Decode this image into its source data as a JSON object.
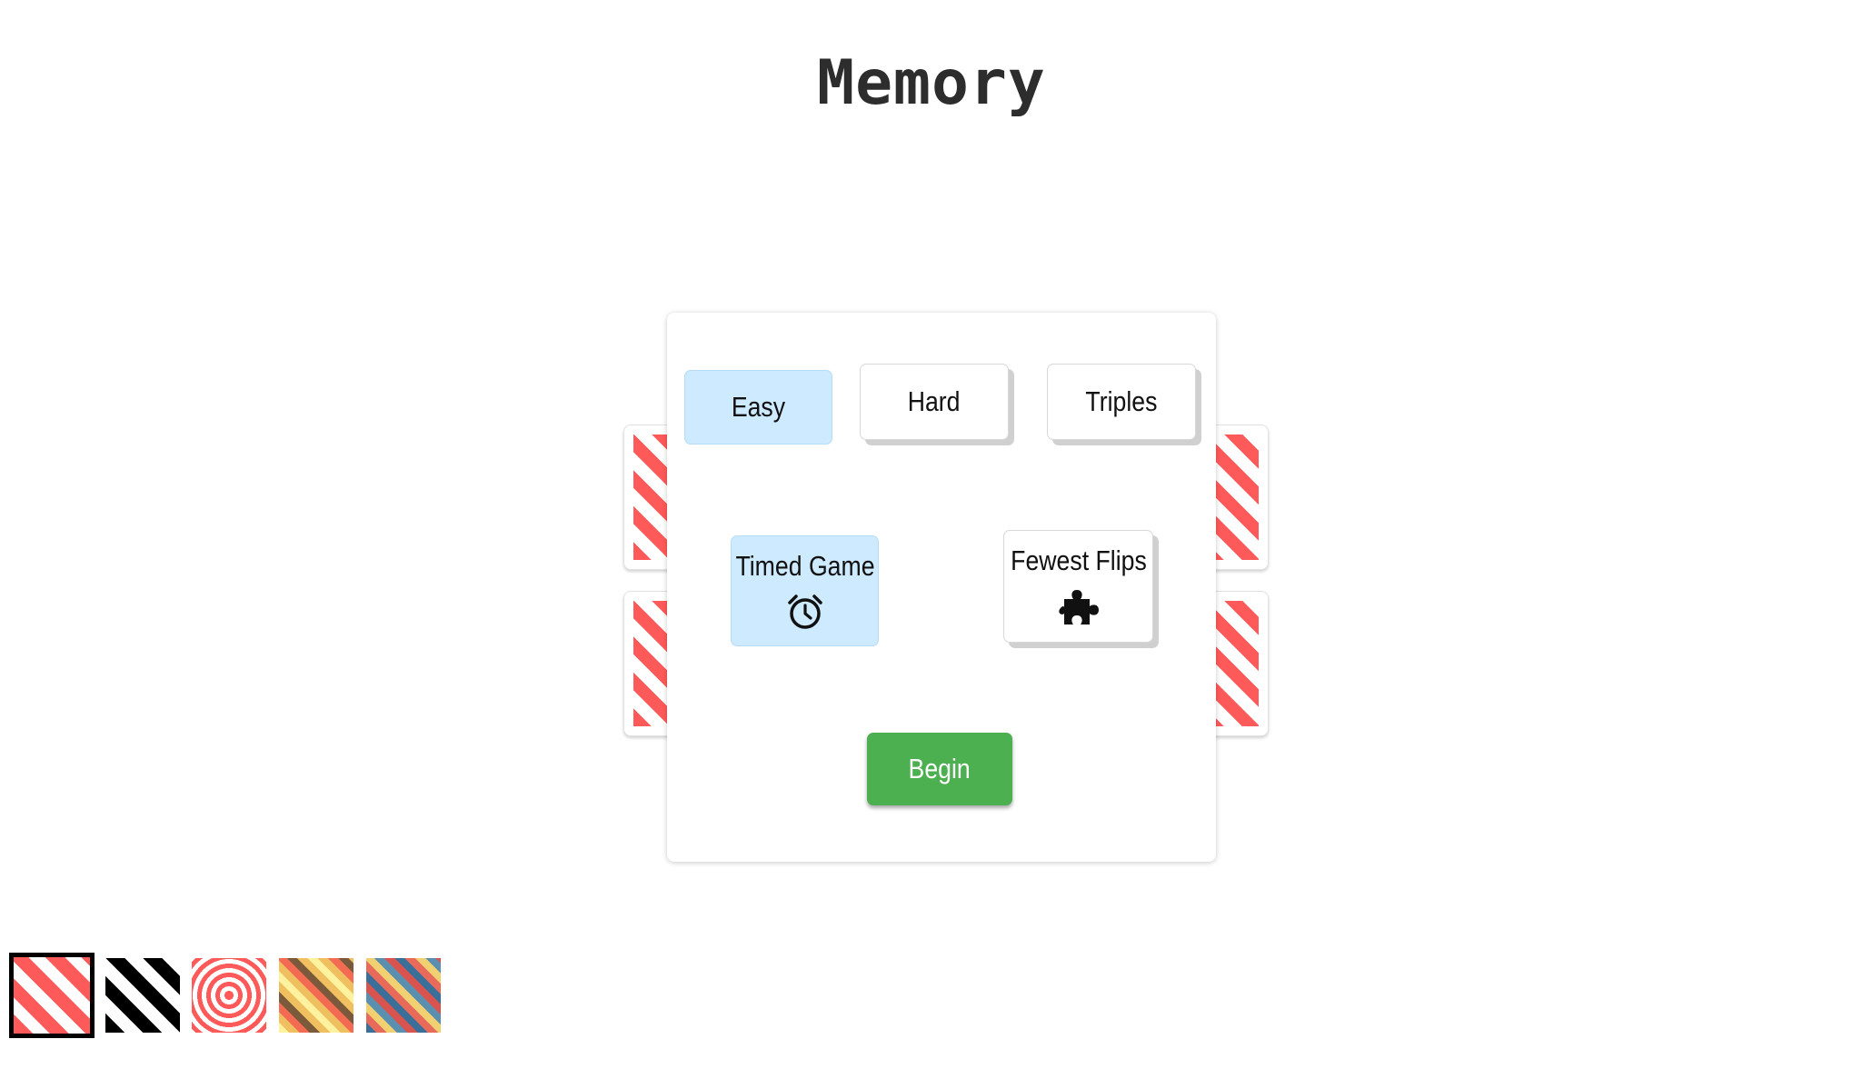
{
  "app": {
    "title": "Memory"
  },
  "difficulty": {
    "options": [
      {
        "label": "Easy",
        "selected": true
      },
      {
        "label": "Hard",
        "selected": false
      },
      {
        "label": "Triples",
        "selected": false
      }
    ]
  },
  "mode": {
    "options": [
      {
        "label": "Timed Game",
        "icon": "alarm-clock-icon",
        "selected": true
      },
      {
        "label": "Fewest Flips",
        "icon": "puzzle-piece-icon",
        "selected": false
      }
    ]
  },
  "begin_button": {
    "label": "Begin",
    "color": "#4caf50"
  },
  "colors": {
    "selected_option": "#cdeaff",
    "card_back_stripe": "#ff5a5a"
  },
  "themes": [
    {
      "name": "red-stripes",
      "selected": true
    },
    {
      "name": "black-stripes",
      "selected": false
    },
    {
      "name": "red-rings",
      "selected": false
    },
    {
      "name": "warm-stripes",
      "selected": false
    },
    {
      "name": "retro-stripes",
      "selected": false
    }
  ]
}
